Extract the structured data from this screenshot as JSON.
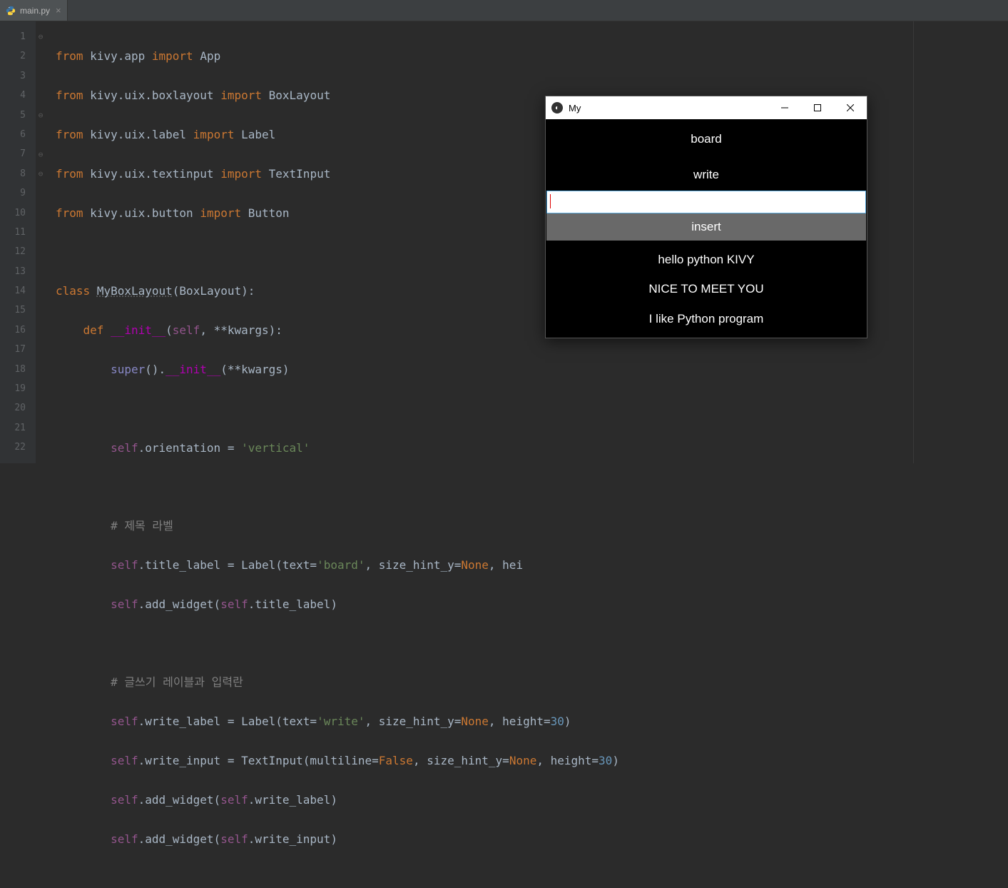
{
  "tab": {
    "filename": "main.py"
  },
  "code": {
    "lines": [
      "1",
      "2",
      "3",
      "4",
      "5",
      "6",
      "7",
      "8",
      "9",
      "10",
      "11",
      "12",
      "13",
      "14",
      "15",
      "16",
      "17",
      "18",
      "19",
      "20",
      "21",
      "22"
    ],
    "l1": {
      "from": "from",
      "m": "kivy.app",
      "imp": "import",
      "n": "App"
    },
    "l2": {
      "from": "from",
      "m": "kivy.uix.boxlayout",
      "imp": "import",
      "n": "BoxLayout"
    },
    "l3": {
      "from": "from",
      "m": "kivy.uix.label",
      "imp": "import",
      "n": "Label"
    },
    "l4": {
      "from": "from",
      "m": "kivy.uix.textinput",
      "imp": "import",
      "n": "TextInput"
    },
    "l5": {
      "from": "from",
      "m": "kivy.uix.button",
      "imp": "import",
      "n": "Button"
    },
    "l7": {
      "cls": "class",
      "name": "MyBoxLayout",
      "base": "BoxLayout",
      "colon": ":"
    },
    "l8": {
      "def": "def",
      "fn": "__init__",
      "self": "self",
      "kw": "**kwargs",
      "close": "):"
    },
    "l9": {
      "super": "super",
      "p": "().",
      "init": "__init__",
      "args": "(**kwargs)"
    },
    "l11": {
      "self": "self",
      "attr": ".orientation = ",
      "val": "'vertical'"
    },
    "l13": {
      "cmt": "# 제목 라벨"
    },
    "l14": {
      "self": "self",
      "a": ".title_label = Label(",
      "text": "text",
      "eq": "=",
      "v": "'board'",
      "c1": ", ",
      "sh": "size_hint_y",
      "eq2": "=",
      "none": "None",
      "c2": ", ",
      "hei": "hei"
    },
    "l15": {
      "self": "self",
      "a": ".add_widget(",
      "self2": "self",
      "b": ".title_label)"
    },
    "l17": {
      "cmt": "# 글쓰기 레이블과 입력란"
    },
    "l18": {
      "self": "self",
      "a": ".write_label = Label(",
      "text": "text",
      "eq": "=",
      "v": "'write'",
      "c1": ", ",
      "sh": "size_hint_y",
      "eq2": "=",
      "none": "None",
      "c2": ", ",
      "h": "height",
      "eq3": "=",
      "n": "30",
      "close": ")"
    },
    "l19": {
      "self": "self",
      "a": ".write_input = TextInput(",
      "ml": "multiline",
      "eq": "=",
      "false": "False",
      "c1": ", ",
      "sh": "size_hint_y",
      "eq2": "=",
      "none": "None",
      "c2": ", ",
      "h": "height",
      "eq3": "=",
      "n": "30",
      "close": ")"
    },
    "l20": {
      "self": "self",
      "a": ".add_widget(",
      "self2": "self",
      "b": ".write_label)"
    },
    "l21": {
      "self": "self",
      "a": ".add_widget(",
      "self2": "self",
      "b": ".write_input)"
    }
  },
  "kivy": {
    "title": "My",
    "board": "board",
    "write": "write",
    "insert": "insert",
    "items": [
      "hello python KIVY",
      "NICE TO MEET YOU",
      "I like Python program"
    ]
  }
}
